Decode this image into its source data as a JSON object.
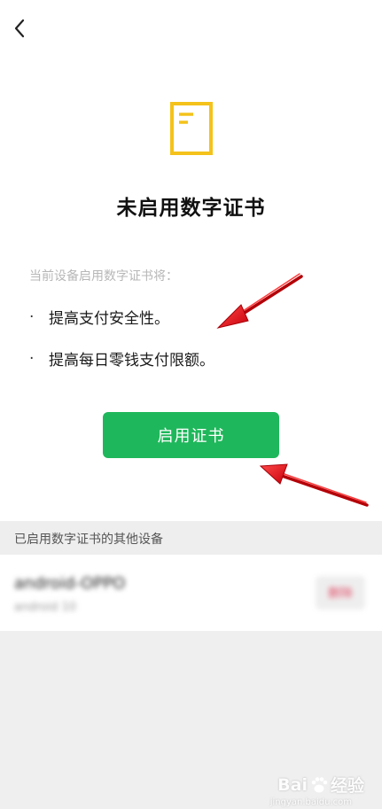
{
  "nav": {
    "back_icon": "chevron-left-icon"
  },
  "main": {
    "icon": "document-certificate-icon",
    "title": "未启用数字证书",
    "description": "当前设备启用数字证书将：",
    "benefits": [
      {
        "bullet": "·",
        "text": "提高支付安全性。"
      },
      {
        "bullet": "·",
        "text": "提高每日零钱支付限额。"
      }
    ],
    "enable_button": "启用证书"
  },
  "devices_section": {
    "header": "已启用数字证书的其他设备",
    "items": [
      {
        "name": "android-OPPO",
        "sub": "android 10",
        "action": "删除"
      }
    ]
  },
  "watermark": {
    "text_left": "Bai",
    "text_right": "经验",
    "sub": "jingyan.baidu.com"
  },
  "colors": {
    "accent_green": "#1fb75b",
    "icon_yellow": "#f4c21b",
    "annotation_red": "#e0141c"
  }
}
